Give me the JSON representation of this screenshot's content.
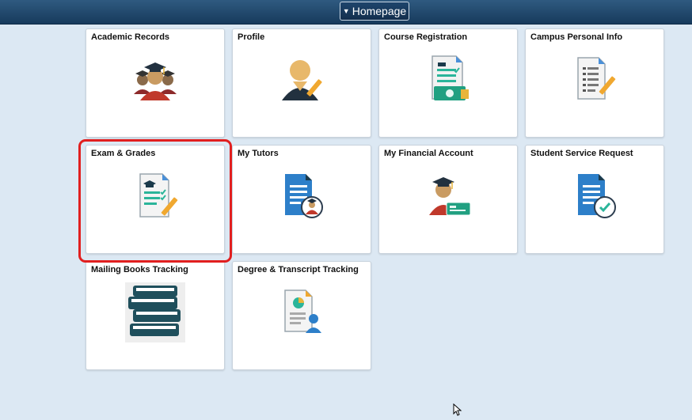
{
  "header": {
    "homepage_label": "Homepage"
  },
  "tiles": [
    {
      "title": "Academic Records",
      "icon": "graduates-icon"
    },
    {
      "title": "Profile",
      "icon": "user-profile-edit-icon"
    },
    {
      "title": "Course Registration",
      "icon": "registration-document-icon"
    },
    {
      "title": "Campus Personal Info",
      "icon": "personal-info-document-icon"
    },
    {
      "title": "Exam & Grades",
      "icon": "exam-grades-document-icon"
    },
    {
      "title": "My Tutors",
      "icon": "tutors-document-icon"
    },
    {
      "title": "My Financial Account",
      "icon": "financial-account-icon"
    },
    {
      "title": "Student Service Request",
      "icon": "service-request-icon"
    },
    {
      "title": "Mailing Books Tracking",
      "icon": "books-stack-icon"
    },
    {
      "title": "Degree & Transcript Tracking",
      "icon": "transcript-tracking-icon"
    }
  ],
  "colors": {
    "highlight": "#e11f1f",
    "header": "#1e456c",
    "page_bg": "#dce8f3"
  }
}
